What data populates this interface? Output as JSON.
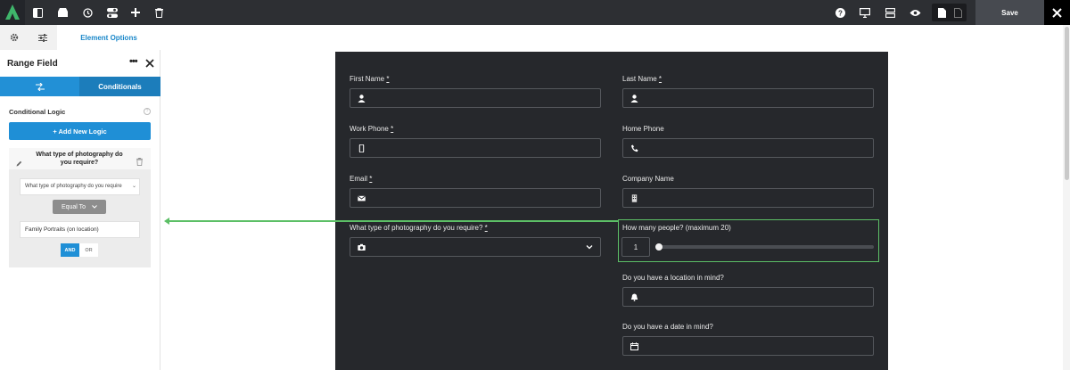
{
  "toolbar": {
    "save_label": "Save",
    "icons": [
      "logo-icon",
      "sidebar-toggle-icon",
      "templates-icon",
      "history-icon",
      "toggles-icon",
      "add-icon",
      "trash-icon",
      "help-icon",
      "desktop-icon",
      "layers-icon",
      "preview-icon",
      "page-icon",
      "blank-page-icon",
      "close-icon"
    ]
  },
  "sidebar": {
    "tab_active": "Element Options",
    "panel_title": "Range Field",
    "subtab_active": "Conditionals",
    "conditional_logic_label": "Conditional Logic",
    "help_mark": "?",
    "add_logic_label": "+ Add New Logic",
    "logic": {
      "question": "What type of photography do you require?",
      "field_select": "What type of photography do you require",
      "operator": "Equal To",
      "value": "Family Portraits (on location)",
      "and_label": "AND",
      "or_label": "OR"
    }
  },
  "form": {
    "first_name": "First Name",
    "last_name": "Last Name",
    "work_phone": "Work Phone",
    "home_phone": "Home Phone",
    "email": "Email",
    "company_name": "Company Name",
    "photography": "What type of photography do you require?",
    "people": "How many people? (maximum 20)",
    "people_value": "1",
    "people_range": {
      "min": 1,
      "max": 20,
      "value": 1
    },
    "location": "Do you have a location in mind?",
    "date": "Do you have a date in mind?",
    "required_mark": "*"
  },
  "colors": {
    "accent": "#1f8fd6",
    "highlight": "#5cbf66",
    "form_bg": "#26282c",
    "topbar_bg": "#2d2f33"
  }
}
